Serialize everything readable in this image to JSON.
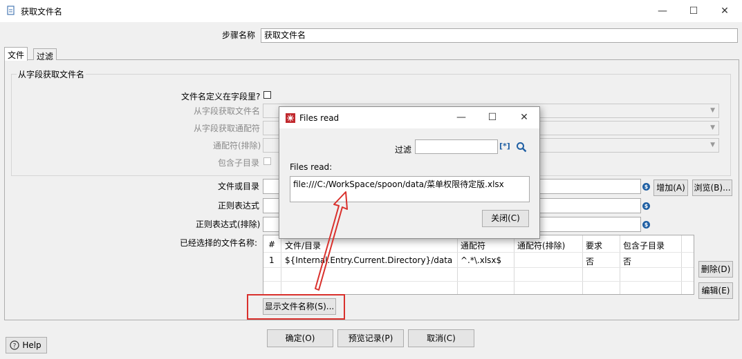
{
  "window": {
    "title": "获取文件名",
    "minimize": "—",
    "maximize": "☐",
    "close": "✕"
  },
  "step_name": {
    "label": "步骤名称",
    "value": "获取文件名"
  },
  "tabs": [
    {
      "label": "文件"
    },
    {
      "label": "过滤"
    }
  ],
  "group": {
    "title": "从字段获取文件名",
    "filename_in_field_label": "文件名定义在字段里?",
    "get_filename_from_field_label": "从字段获取文件名",
    "get_wildcard_from_field_label": "从字段获取通配符",
    "wildcard_exclude_label": "通配符(排除)",
    "include_subfolders_label": "包含子目录"
  },
  "file_or_dir": {
    "label": "文件或目录",
    "add_button": "增加(A)",
    "browse_button": "浏览(B)..."
  },
  "regex": {
    "label": "正则表达式"
  },
  "regex_exclude": {
    "label": "正则表达式(排除)"
  },
  "selected_files": {
    "label": "已经选择的文件名称:",
    "columns": [
      "#",
      "文件/目录",
      "通配符",
      "通配符(排除)",
      "要求",
      "包含子目录"
    ],
    "rows": [
      {
        "num": "1",
        "path": "${Internal.Entry.Current.Directory}/data",
        "wildcard": "^.*\\.xlsx$",
        "exclude": "",
        "required": "否",
        "subfolders": "否"
      }
    ],
    "delete_button": "删除(D)",
    "edit_button": "编辑(E)"
  },
  "show_filenames_button": "显示文件名称(S)...",
  "footer": {
    "ok": "确定(O)",
    "preview": "预览记录(P)",
    "cancel": "取消(C)",
    "help": "Help"
  },
  "files_read_dialog": {
    "title": "Files read",
    "filter_label": "过滤",
    "filter_value": "",
    "content_label": "Files read:",
    "file": "file:///C:/WorkSpace/spoon/data/菜单权限待定版.xlsx",
    "close_button": "关闭(C)"
  },
  "accent_colors": {
    "annotation_red": "#d9302c",
    "variable_icon_blue": "#1f5fa3"
  }
}
